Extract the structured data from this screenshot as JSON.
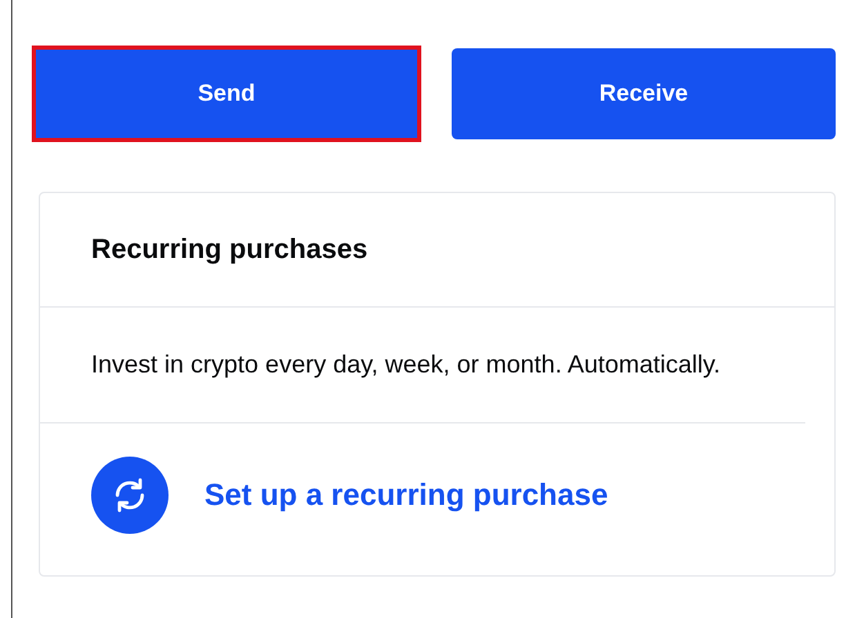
{
  "buttons": [
    {
      "label": "Send",
      "highlighted": true
    },
    {
      "label": "Receive",
      "highlighted": false
    }
  ],
  "card": {
    "title": "Recurring purchases",
    "description": "Invest in crypto every day, week, or month. Automatically.",
    "action": "Set up a recurring purchase"
  }
}
